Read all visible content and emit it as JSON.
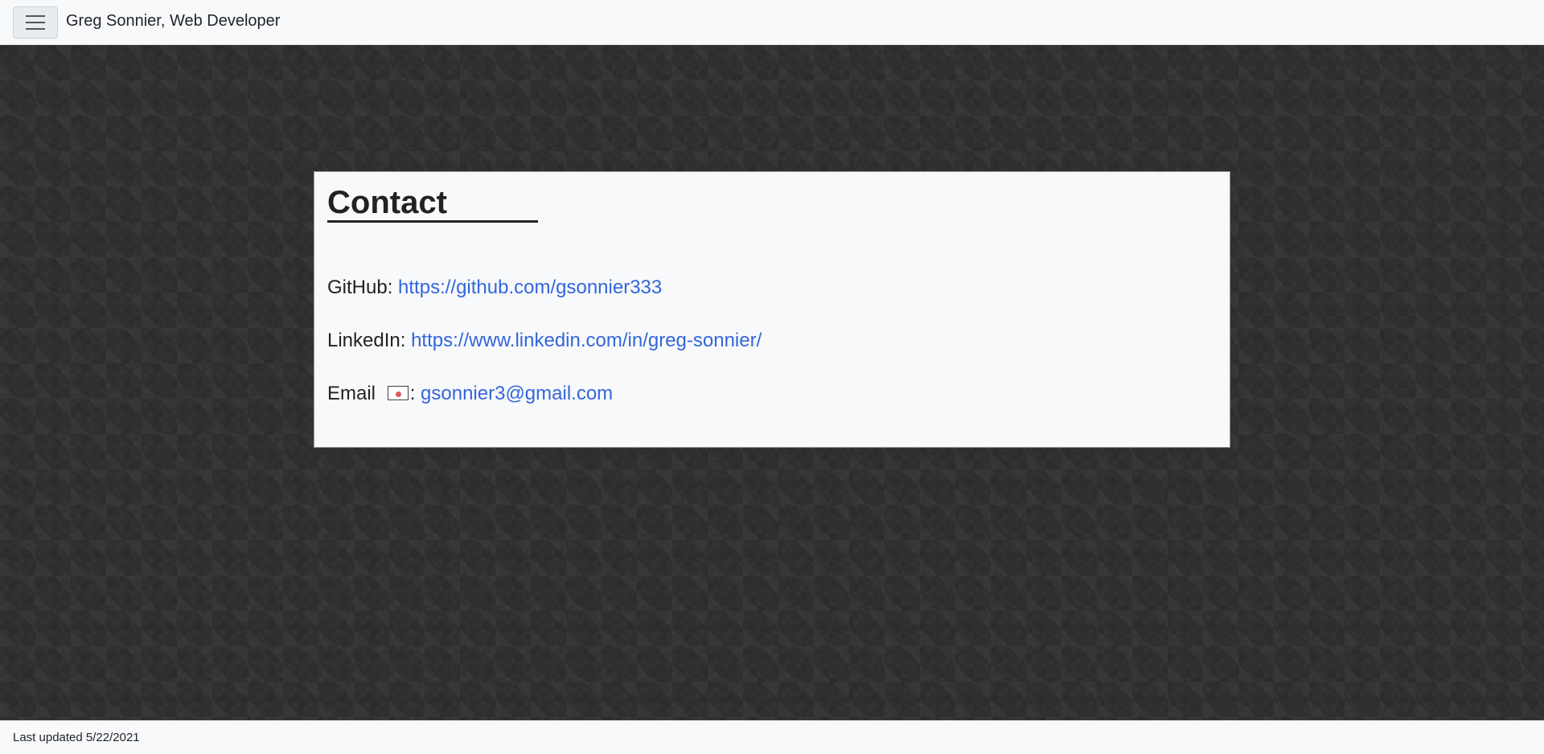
{
  "navbar": {
    "brand": "Greg Sonnier, Web Developer",
    "menu_icon": "hamburger-menu-icon"
  },
  "contact": {
    "title": "Contact",
    "github": {
      "label": "GitHub: ",
      "url": "https://github.com/gsonnier333"
    },
    "linkedin": {
      "label": "LinkedIn: ",
      "url": "https://www.linkedin.com/in/greg-sonnier/"
    },
    "email": {
      "label": "Email ",
      "icon": "envelope-icon",
      "separator": ": ",
      "address": "gsonnier3@gmail.com"
    }
  },
  "footer": {
    "text": "Last updated 5/22/2021"
  },
  "colors": {
    "link": "#3366dd",
    "background": "#2f2f2f",
    "card": "#f8f9fa"
  }
}
